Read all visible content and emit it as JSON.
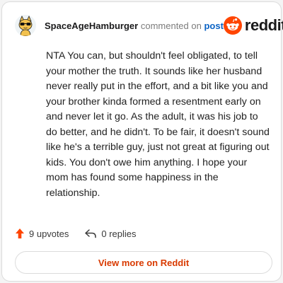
{
  "comment": {
    "username": "SpaceAgeHamburger",
    "action_text": "commented on",
    "post_link": "post",
    "body": "NTA You can, but shouldn't feel obligated, to tell your mother the truth. It sounds like her husband never really put in the effort, and a bit like you and your brother kinda formed a resentment early on and never let it go. As the adult, it was his job to do better, and he didn't. To be fair, it doesn't sound like he's a terrible guy, just not great at figuring out kids. You don't owe him anything. I hope your mom has found some happiness in the relationship."
  },
  "brand": {
    "wordmark": "reddit",
    "icon": "reddit-snoo-icon",
    "color": "#ff4500"
  },
  "stats": {
    "upvotes": "9 upvotes",
    "replies": "0 replies",
    "upvote_icon": "upvote-arrow-icon",
    "reply_icon": "reply-arrow-icon"
  },
  "cta": {
    "label": "View more on Reddit",
    "color": "#d93a00"
  },
  "avatar": {
    "icon": "cat-sunglasses-avatar-icon"
  }
}
